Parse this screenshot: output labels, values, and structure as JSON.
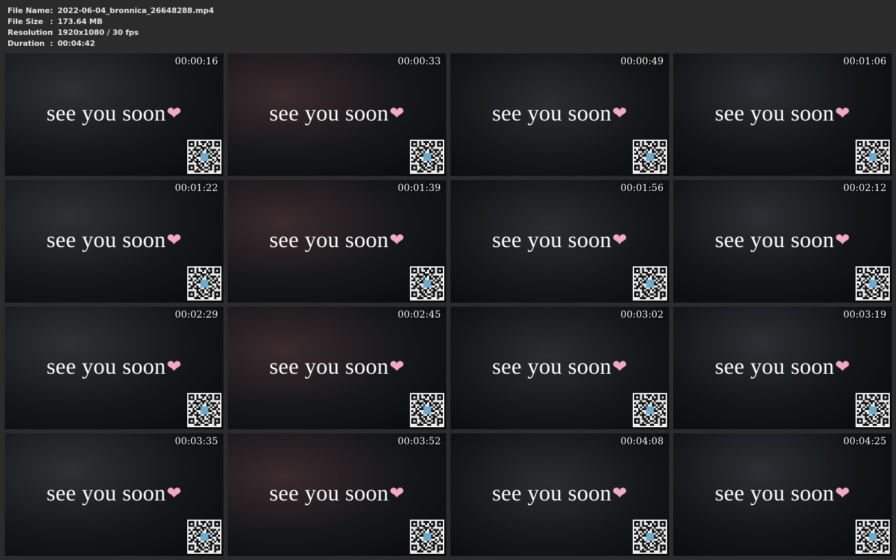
{
  "file_info": {
    "rows": [
      {
        "label": "File Name",
        "sep": ":",
        "value": "2022-06-04_bronnica_26648288.mp4"
      },
      {
        "label": "File Size",
        "sep": ":",
        "value": "173.64 MB"
      },
      {
        "label": "Resolution",
        "sep": ":",
        "value": "1920x1080 / 30 fps"
      },
      {
        "label": "Duration",
        "sep": ":",
        "value": "00:04:42"
      }
    ]
  },
  "thumbnails": [
    {
      "timestamp": "00:00:16",
      "caption": "see you soon",
      "heart": "❤"
    },
    {
      "timestamp": "00:00:33",
      "caption": "see you soon",
      "heart": "❤"
    },
    {
      "timestamp": "00:00:49",
      "caption": "see you soon",
      "heart": "❤"
    },
    {
      "timestamp": "00:01:06",
      "caption": "see you soon",
      "heart": "❤"
    },
    {
      "timestamp": "00:01:22",
      "caption": "see you soon",
      "heart": "❤"
    },
    {
      "timestamp": "00:01:39",
      "caption": "see you soon",
      "heart": "❤"
    },
    {
      "timestamp": "00:01:56",
      "caption": "see you soon",
      "heart": "❤"
    },
    {
      "timestamp": "00:02:12",
      "caption": "see you soon",
      "heart": "❤"
    },
    {
      "timestamp": "00:02:29",
      "caption": "see you soon",
      "heart": "❤"
    },
    {
      "timestamp": "00:02:45",
      "caption": "see you soon",
      "heart": "❤"
    },
    {
      "timestamp": "00:03:02",
      "caption": "see you soon",
      "heart": "❤"
    },
    {
      "timestamp": "00:03:19",
      "caption": "see you soon",
      "heart": "❤"
    },
    {
      "timestamp": "00:03:35",
      "caption": "see you soon",
      "heart": "❤"
    },
    {
      "timestamp": "00:03:52",
      "caption": "see you soon",
      "heart": "❤"
    },
    {
      "timestamp": "00:04:08",
      "caption": "see you soon",
      "heart": "❤"
    },
    {
      "timestamp": "00:04:25",
      "caption": "see you soon",
      "heart": "❤"
    }
  ],
  "colors": {
    "page_background": "#2b2b2b",
    "info_text": "#e8e8e8",
    "caption_text": "#ffffff",
    "heart": "#f2a9c2",
    "thumbnail_dark": "#0d0f10"
  },
  "icons": {
    "heart": "heart-icon",
    "qr": "qr-code-icon"
  }
}
